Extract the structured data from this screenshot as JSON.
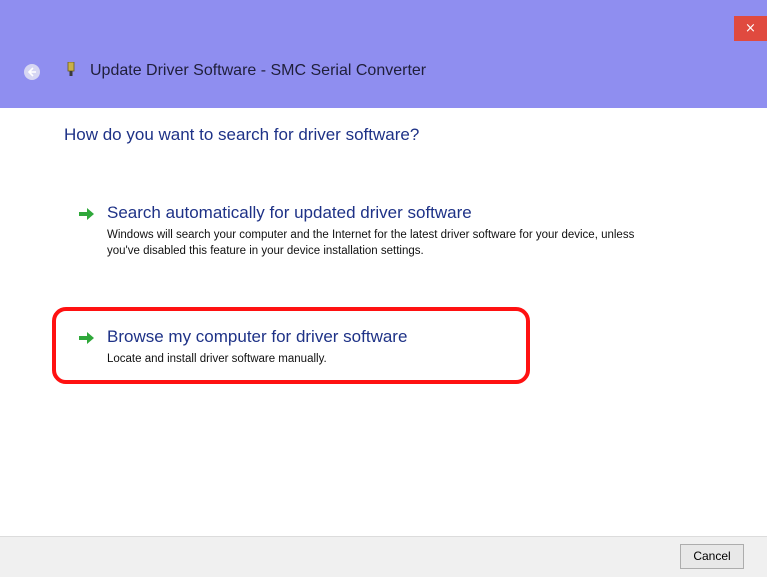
{
  "window": {
    "title": "Update Driver Software - SMC Serial Converter",
    "close_glyph": "×"
  },
  "content": {
    "heading": "How do you want to search for driver software?",
    "options": [
      {
        "title": "Search automatically for updated driver software",
        "description": "Windows will search your computer and the Internet for the latest driver software for your device, unless you've disabled this feature in your device installation settings.",
        "icon": "green-arrow-icon"
      },
      {
        "title": "Browse my computer for driver software",
        "description": "Locate and install driver software manually.",
        "icon": "green-arrow-icon",
        "highlighted": true
      }
    ]
  },
  "footer": {
    "cancel_label": "Cancel"
  },
  "colors": {
    "titlebar": "#8f8ef0",
    "link_blue": "#1e3287",
    "arrow_green": "#2fa83a",
    "highlight_red": "#ff1111",
    "close_red": "#e04a3f"
  }
}
